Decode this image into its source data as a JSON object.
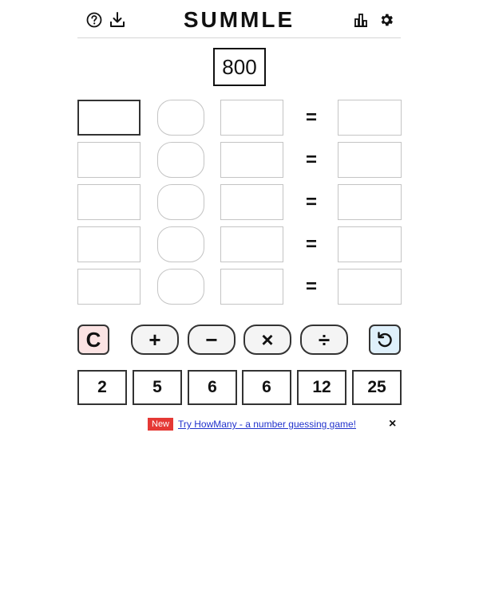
{
  "header": {
    "title": "SUMMLE",
    "icons": [
      "help-icon",
      "download-icon",
      "stats-icon",
      "settings-icon"
    ]
  },
  "target": "800",
  "equals_sign": "=",
  "operators": {
    "clear": "C",
    "plus": "+",
    "minus": "−",
    "times": "×",
    "divide": "÷",
    "undo_icon": "undo-icon"
  },
  "numbers": [
    "2",
    "5",
    "6",
    "6",
    "12",
    "25"
  ],
  "promo": {
    "badge": "New",
    "link_text": "Try HowMany - a number guessing game!",
    "close": "×"
  },
  "colors": {
    "clear_bg": "#fbe3e3",
    "undo_bg": "#dff0fb",
    "badge_bg": "#e53935",
    "link": "#2233cc"
  }
}
